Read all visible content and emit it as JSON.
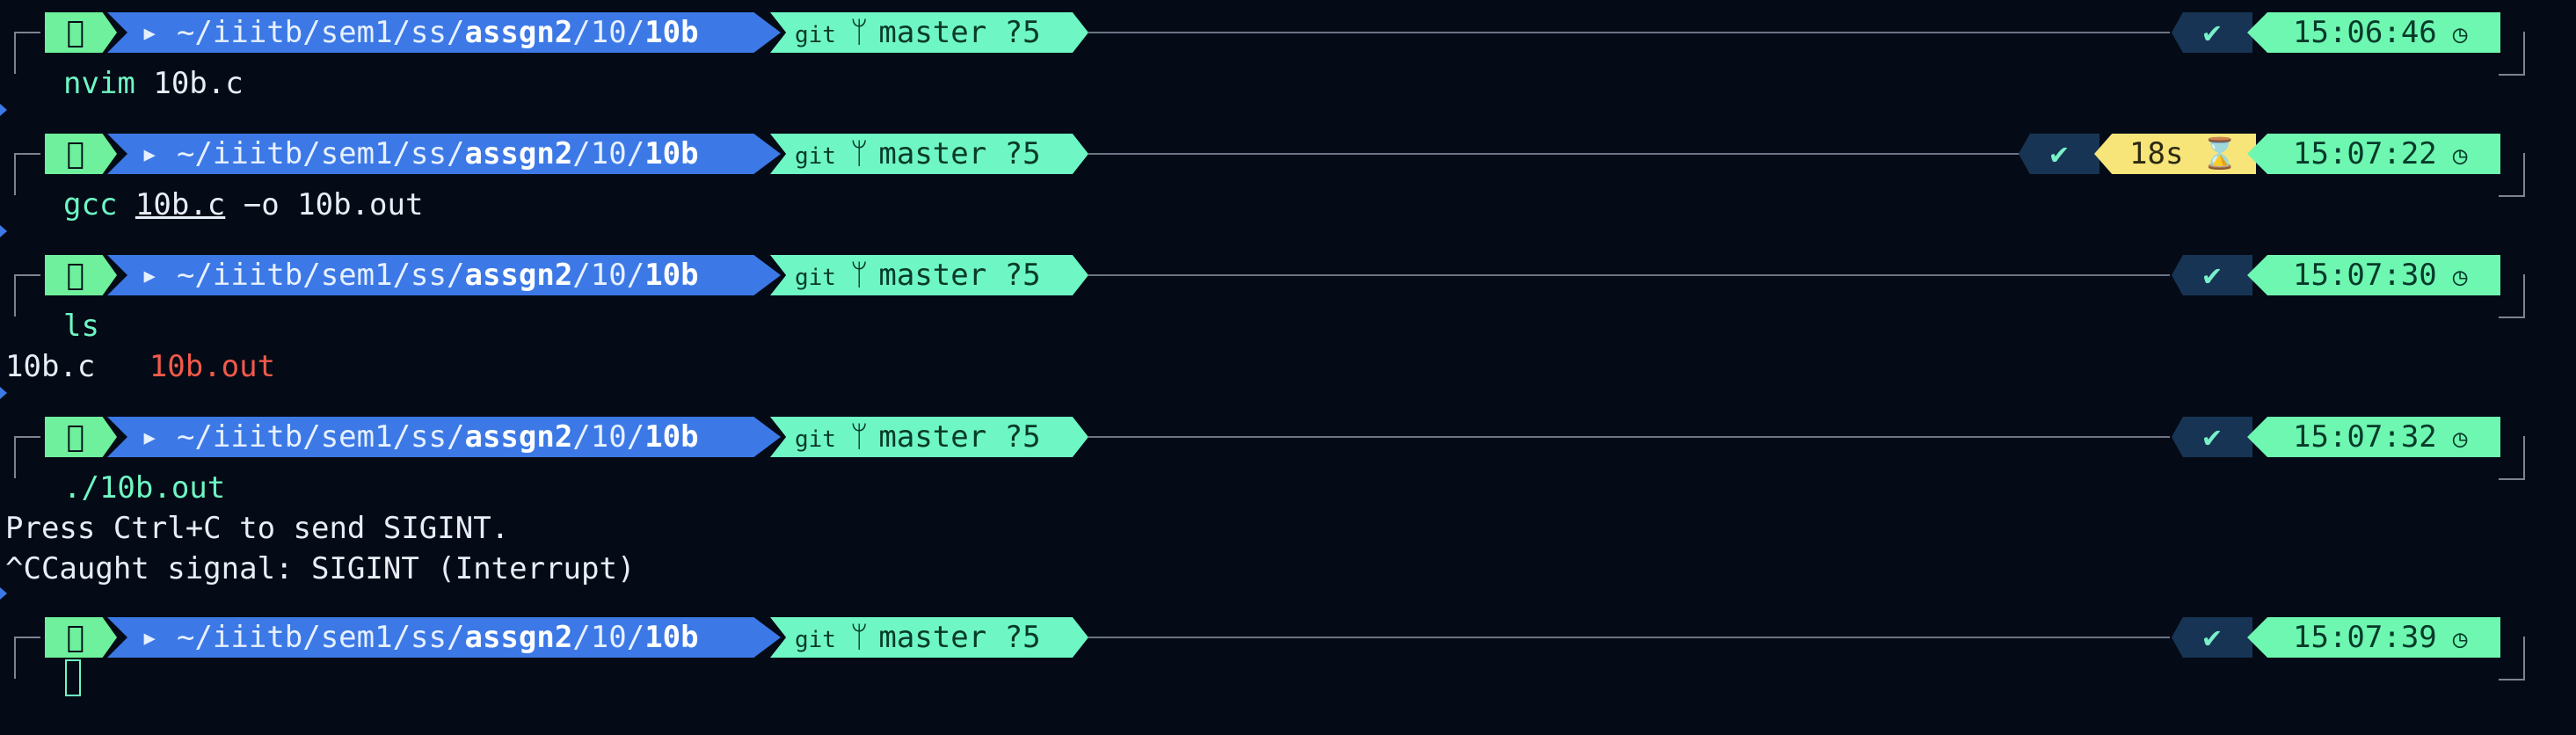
{
  "prompt": {
    "path_prefix": "~/iiitb/sem1/ss/",
    "path_bold1": "assgn2",
    "path_mid": "/10/",
    "path_bold2": "10b",
    "git_label": "git",
    "branch_icon": "ᚠ",
    "branch": "master ?5",
    "status_icon": "✔",
    "clock_icon": "◷",
    "apple_icon": "",
    "folder_icon": "📂"
  },
  "blocks": [
    {
      "command": "nvim",
      "args": " 10b.c",
      "time": "15:06:46",
      "duration": "",
      "output": []
    },
    {
      "command": "gcc",
      "args_ul": "10b.c",
      "args": " −o 10b.out",
      "time": "15:07:22",
      "duration": "18s ⌛",
      "output": []
    },
    {
      "command": "ls",
      "args": "",
      "time": "15:07:30",
      "duration": "",
      "output_ls": {
        "file1": "10b.c",
        "file2": "10b.out"
      }
    },
    {
      "command": "./10b.out",
      "args": "",
      "time": "15:07:32",
      "duration": "",
      "output": [
        "Press Ctrl+C to send SIGINT.",
        "^CCaught signal: SIGINT (Interrupt)"
      ]
    },
    {
      "command": "",
      "args": "",
      "time": "15:07:39",
      "duration": "",
      "output": []
    }
  ],
  "colors": {
    "background": "#050b16",
    "apple_segment": "#6ef09c",
    "path_segment": "#3c79e6",
    "git_segment": "#6ef7c4",
    "status_segment": "#173454",
    "duration_segment": "#f7e57a",
    "time_segment": "#6ef7b0",
    "command": "#6ef7c4",
    "executable_file": "#f25a4a"
  }
}
